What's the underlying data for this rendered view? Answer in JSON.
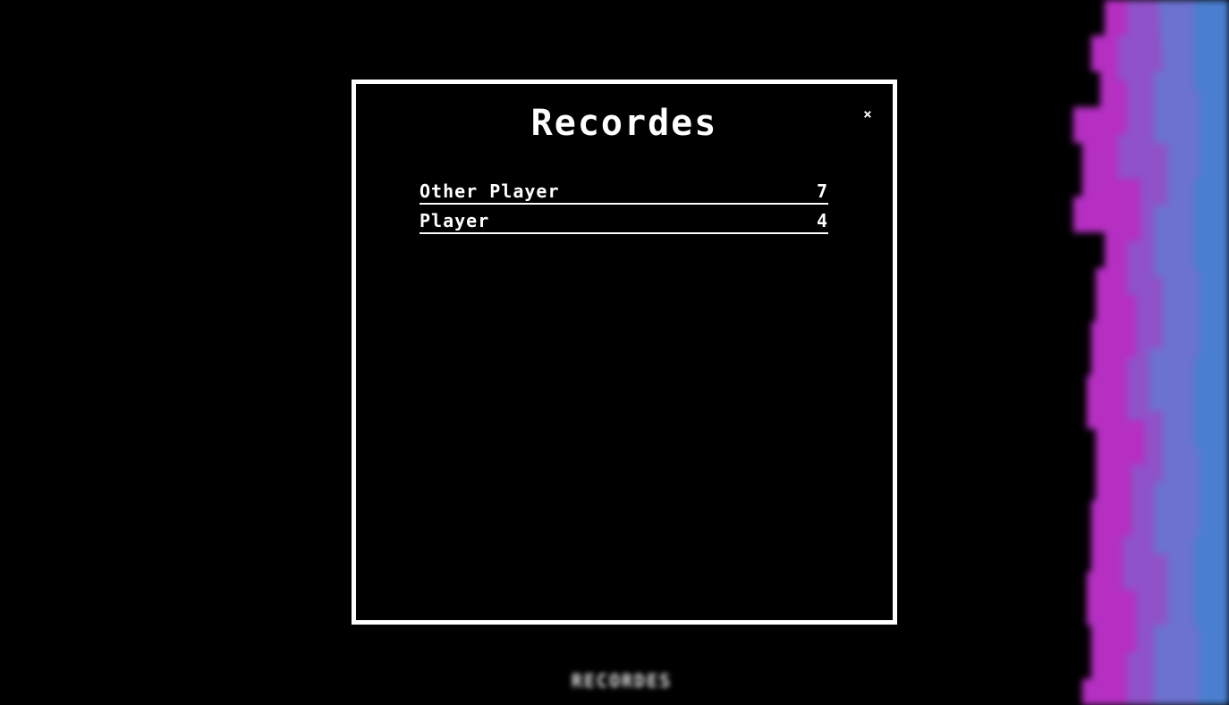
{
  "modal": {
    "title": "Recordes",
    "close_label": "×"
  },
  "scores": [
    {
      "name": "Other Player",
      "value": "7"
    },
    {
      "name": "Player",
      "value": "4"
    }
  ],
  "footer": {
    "label": "RECORDES"
  },
  "colors": {
    "background": "#000000",
    "modal_border": "#ffffff",
    "stripe_magenta": "#b52fc2",
    "stripe_violet": "#8f52c8",
    "stripe_blue": "#4a7fd0"
  }
}
